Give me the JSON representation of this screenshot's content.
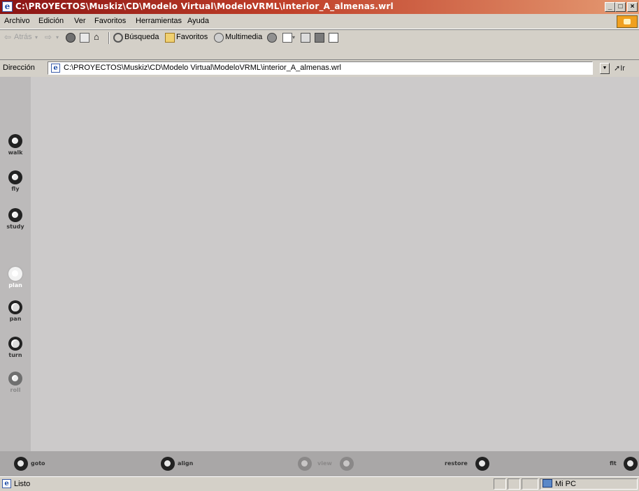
{
  "window": {
    "title": "C:\\PROYECTOS\\Muskiz\\CD\\Modelo Virtual\\ModeloVRML\\interior_A_almenas.wrl",
    "app_icon": "ie-page-icon",
    "controls": {
      "minimize": "_",
      "maximize": "□",
      "close": "×"
    }
  },
  "menu": {
    "items": [
      "Archivo",
      "Edición",
      "Ver",
      "Favoritos",
      "Herramientas",
      "Ayuda"
    ]
  },
  "toolbar": {
    "back": "Atrás",
    "search": "Búsqueda",
    "favorites": "Favoritos",
    "multimedia": "Multimedia"
  },
  "address": {
    "label": "Dirección",
    "url": "C:\\PROYECTOS\\Muskiz\\CD\\Modelo Virtual\\ModeloVRML\\interior_A_almenas.wrl",
    "go": "Ir"
  },
  "vrml": {
    "nav_left": [
      {
        "id": "walk",
        "label": "walk"
      },
      {
        "id": "fly",
        "label": "fly"
      },
      {
        "id": "study",
        "label": "study"
      },
      {
        "id": "plan",
        "label": "plan"
      },
      {
        "id": "pan",
        "label": "pan"
      },
      {
        "id": "turn",
        "label": "turn"
      },
      {
        "id": "roll",
        "label": "roll"
      }
    ],
    "nav_bottom": {
      "goto": "goto",
      "align": "align",
      "view": "view",
      "restore": "restore",
      "fit": "fit"
    }
  },
  "status": {
    "text": "Listo",
    "zone": "Mi PC"
  },
  "colors": {
    "titlebar_start": "#8a1414",
    "titlebar_end": "#e59a72",
    "chrome": "#d4d0c8",
    "viewport": "#cccaca"
  }
}
